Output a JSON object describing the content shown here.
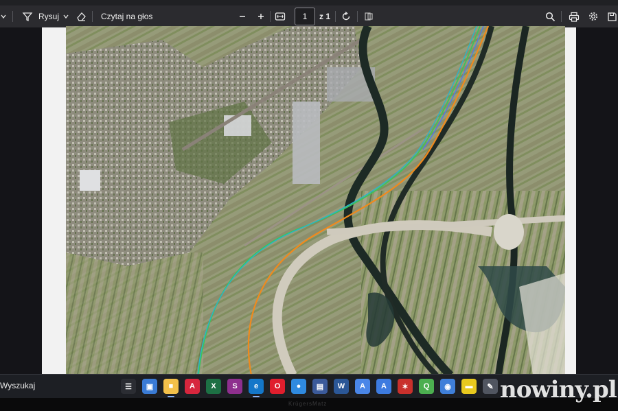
{
  "toolbar": {
    "draw_label": "Rysuj",
    "read_aloud_label": "Czytaj na głos",
    "page_current": "1",
    "page_total": "z 1"
  },
  "taskbar": {
    "search_label": "Wyszukaj",
    "apps": [
      {
        "name": "task-view",
        "color": "#2b2d33",
        "glyph": "☰"
      },
      {
        "name": "store",
        "color": "#3a7bd5",
        "glyph": "▣"
      },
      {
        "name": "file-explorer",
        "color": "#f3c04a",
        "glyph": "■"
      },
      {
        "name": "acrobat",
        "color": "#d7263d",
        "glyph": "A"
      },
      {
        "name": "excel",
        "color": "#1d7044",
        "glyph": "X"
      },
      {
        "name": "shape-app",
        "color": "#8e2f8e",
        "glyph": "S"
      },
      {
        "name": "edge",
        "color": "#1477c9",
        "glyph": "e"
      },
      {
        "name": "opera",
        "color": "#e01e2d",
        "glyph": "O"
      },
      {
        "name": "messenger",
        "color": "#2f8ae0",
        "glyph": "●"
      },
      {
        "name": "save-app",
        "color": "#3b5a9a",
        "glyph": "▤"
      },
      {
        "name": "word",
        "color": "#2b5797",
        "glyph": "W"
      },
      {
        "name": "font-app-a",
        "color": "#4a86e8",
        "glyph": "A"
      },
      {
        "name": "font-app-b",
        "color": "#3d7be0",
        "glyph": "A"
      },
      {
        "name": "puzzle-app",
        "color": "#c9302c",
        "glyph": "✶"
      },
      {
        "name": "q-app",
        "color": "#4caf50",
        "glyph": "Q"
      },
      {
        "name": "globe-app",
        "color": "#3f7fd9",
        "glyph": "◉"
      },
      {
        "name": "notes-app",
        "color": "#e8c81e",
        "glyph": "▬"
      },
      {
        "name": "pen-app",
        "color": "#505560",
        "glyph": "✎"
      }
    ]
  },
  "bezel_brand": "KrügersMatz",
  "watermark": "nowiny.pl",
  "colors": {
    "toolbar_bg": "#2b2b2f",
    "taskbar_bg": "#1d1f24",
    "route_orange": "#f08a1c",
    "route_green": "#3ec35a",
    "route_cyan": "#29b6c8",
    "route_blue": "#4d7de8"
  }
}
